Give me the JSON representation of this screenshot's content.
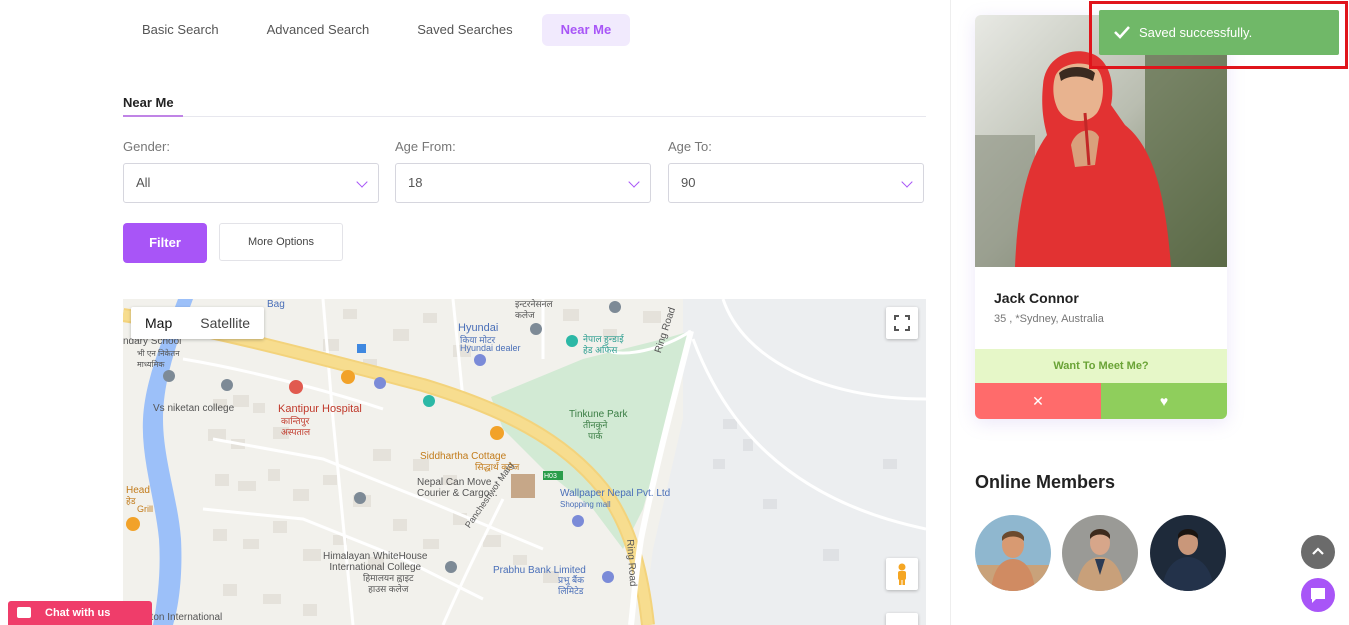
{
  "tabs": [
    {
      "label": "Basic Search"
    },
    {
      "label": "Advanced Search"
    },
    {
      "label": "Saved Searches"
    },
    {
      "label": "Near Me"
    }
  ],
  "section_title": "Near Me",
  "fields": {
    "gender": {
      "label": "Gender:",
      "value": "All"
    },
    "age_from": {
      "label": "Age From:",
      "value": "18"
    },
    "age_to": {
      "label": "Age To:",
      "value": "90"
    }
  },
  "buttons": {
    "filter": "Filter",
    "more_options": "More Options"
  },
  "map": {
    "type_map": "Map",
    "type_satellite": "Satellite",
    "labels": {
      "school": "ndary School",
      "school_np": "भी एन निकेतन\nमाध्यमिक",
      "vs_niketan": "Vs niketan college",
      "kantipur": "Kantipur Hospital",
      "kantipur_np": "कान्तिपुर\nअस्पताल",
      "hyundai": "Hyundai",
      "hyundai_np": "किया मोटर",
      "hyundai_dealer": "Hyundai dealer",
      "intl_np": "इन्टरनेसनल\nकलेज",
      "nepal_np": "नेपाल हुन्डाई\nहेड अफिस",
      "tinkune": "Tinkune Park",
      "tinkune_np": "तीनकुने\nपार्क",
      "ring_road": "Ring Road",
      "siddhartha": "Siddhartha Cottage",
      "siddhartha_np": "सिद्धार्थ कटेज",
      "nepal_can": "Nepal Can Move -\nCourier & Cargo...",
      "wallpaper": "Wallpaper Nepal Pvt. Ltd",
      "shopping": "Shopping mall",
      "head": "Head",
      "head_np": "हेड",
      "grill": "Grill",
      "pancheshwor": "Pancheshwor Marg",
      "himalayan": "Himalayan WhiteHouse\nInternational College",
      "himalayan_np": "हिमालयन ह्वाइट\nहाउस कलेज",
      "prabhu": "Prabhu Bank Limited",
      "prabhu_np": "प्रभु बैंक\nलिमिटेड",
      "h03": "H03",
      "oriton": "riton International",
      "bag": "Bag"
    }
  },
  "profile": {
    "name": "Jack Connor",
    "meta": "35 , *Sydney, Australia",
    "meet_label": "Want To Meet Me?",
    "dislike_icon": "✕",
    "like_icon": "♥"
  },
  "online_title": "Online Members",
  "toast": {
    "message": "Saved successfully."
  },
  "chat_tab": "Chat with us",
  "colors": {
    "accent": "#a855f7",
    "success": "#70b868",
    "danger": "#ff6b6b",
    "like": "#8fce5c"
  }
}
